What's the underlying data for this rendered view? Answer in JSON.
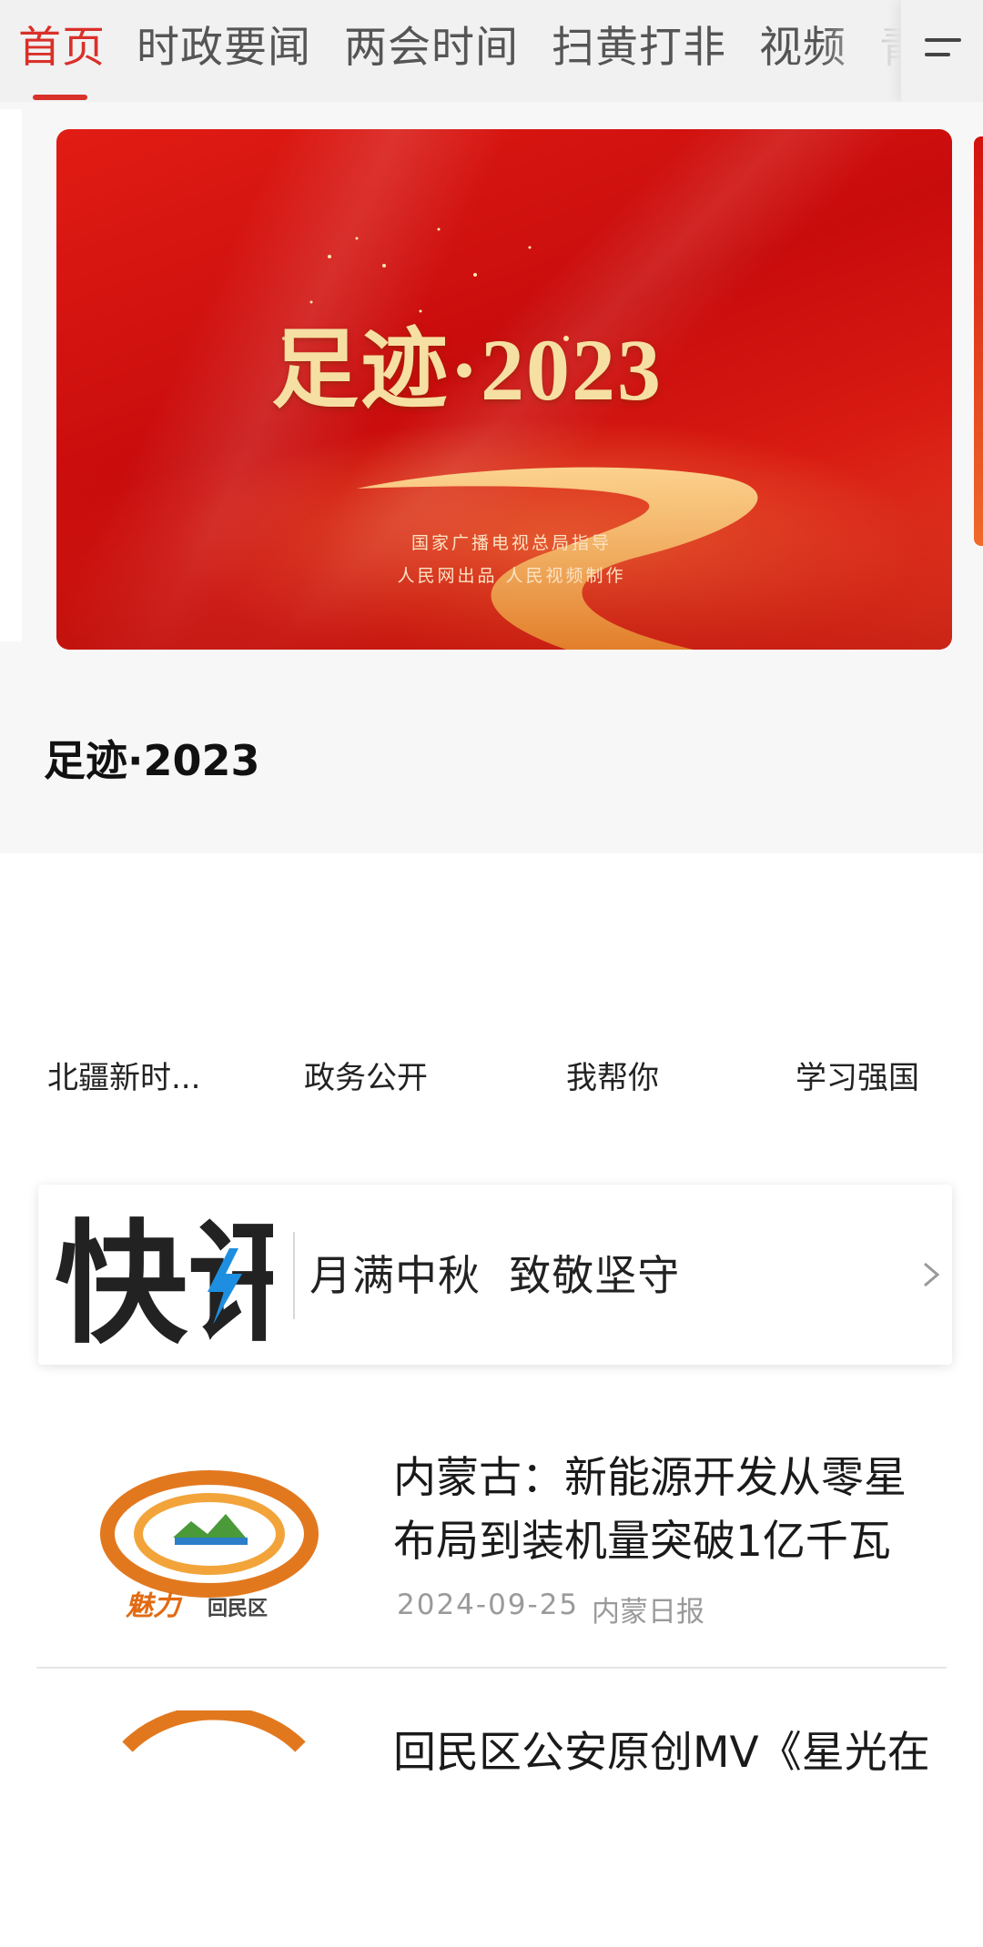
{
  "tabs": [
    {
      "label": "首页",
      "active": true
    },
    {
      "label": "时政要闻",
      "active": false
    },
    {
      "label": "两会时间",
      "active": false
    },
    {
      "label": "扫黄打非",
      "active": false
    },
    {
      "label": "视频",
      "active": false
    },
    {
      "label": "青",
      "active": false
    }
  ],
  "menu": {
    "icon": "menu-icon"
  },
  "banner": {
    "image_title": "足迹·2023",
    "image_sub1": "国家广播电视总局指导",
    "image_sub2": "人民网出品 人民视频制作",
    "caption": "足迹·2023"
  },
  "shortcuts": [
    {
      "label": "北疆新时..."
    },
    {
      "label": "政务公开"
    },
    {
      "label": "我帮你"
    },
    {
      "label": "学习强国"
    }
  ],
  "flash": {
    "logo_text": "快讯",
    "text": "月满中秋  致敬坚守",
    "icon": "chevron-right-icon"
  },
  "news": [
    {
      "title": "内蒙古：新能源开发从零星布局到装机量突破1亿千瓦",
      "date": "2024-09-25",
      "source": "内蒙日报",
      "thumb_text": "魅力 回民区"
    },
    {
      "title": "回民区公安原创MV《星光在",
      "date": "",
      "source": ""
    }
  ],
  "colors": {
    "accent": "#d9302a",
    "banner_red": "#d81a12",
    "gold": "#f6dfa2"
  }
}
